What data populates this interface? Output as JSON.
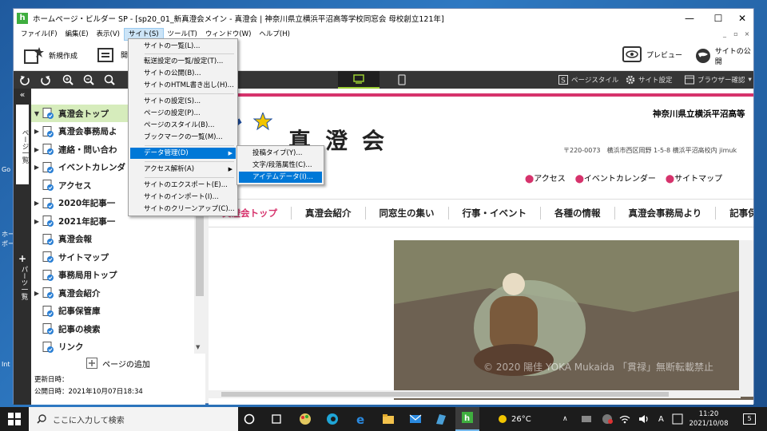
{
  "window": {
    "title": "ホームページ・ビルダー SP - [sp20_01_新真澄会メイン - 真澄会 | 神奈川県立横浜平沼高等学校同窓会 母校創立121年]",
    "app_icon": "h",
    "minimize": "—",
    "maximize": "☐",
    "close": "✕"
  },
  "menubar": [
    "ファイル(F)",
    "編集(E)",
    "表示(V)",
    "サイト(S)",
    "ツール(T)",
    "ウィンドウ(W)",
    "ヘルプ(H)"
  ],
  "toolbar": {
    "new": "新規作成",
    "open": "開",
    "preview": "プレビュー",
    "publish": "サイトの公開"
  },
  "toolbar2": {
    "page_style": "ページスタイル",
    "site_settings": "サイト設定",
    "browser_check": "ブラウザー確認"
  },
  "vtabs": {
    "pages": "ページ一覧",
    "parts": "パーツ一覧"
  },
  "tree": [
    {
      "label": "真澄会トップ",
      "expand": "▼",
      "selected": true
    },
    {
      "label": "真澄会事務局よ",
      "expand": "▶"
    },
    {
      "label": "連絡・問い合わ",
      "expand": "▶"
    },
    {
      "label": "イベントカレンダ",
      "expand": "▶"
    },
    {
      "label": "アクセス",
      "expand": ""
    },
    {
      "label": "2020年記事一",
      "expand": "▶"
    },
    {
      "label": "2021年記事一",
      "expand": "▶"
    },
    {
      "label": "真澄会報",
      "expand": ""
    },
    {
      "label": "サイトマップ",
      "expand": ""
    },
    {
      "label": "事務局用トップ",
      "expand": ""
    },
    {
      "label": "真澄会紹介",
      "expand": "▶"
    },
    {
      "label": "記事保管庫",
      "expand": ""
    },
    {
      "label": "記事の検索",
      "expand": ""
    },
    {
      "label": "リンク",
      "expand": ""
    }
  ],
  "add_page": "ページの追加",
  "dates": {
    "updated": "更新日時：",
    "published": "公開日時：2021年10月07日18:34"
  },
  "site_menu": {
    "items": [
      "サイトの一覧(L)...",
      "転送設定の一覧/設定(T)...",
      "サイトの公開(B)...",
      "サイトのHTML書き出し(H)...",
      "サイトの設定(S)...",
      "ページの設定(P)...",
      "ページのスタイル(B)...",
      "ブックマークの一覧(M)...",
      "データ管理(D)",
      "アクセス解析(A)",
      "サイトのエクスポート(E)...",
      "サイトのインポート(I)...",
      "サイトのクリーンアップ(C)..."
    ],
    "sub_arrow": "▶"
  },
  "data_submenu": [
    "投稿タイプ(Y)...",
    "文字/段落属性(C)...",
    "アイテムデータ(I)..."
  ],
  "page": {
    "school": "神奈川県立横浜平沼高等",
    "site_title": "真澄会",
    "address": "〒220-0073　横浜市西区岡野 1-5-8 横浜平沼高校内 jimuk",
    "links": [
      "アクセス",
      "イベントカレンダー",
      "サイトマップ"
    ],
    "nav": [
      "真澄会トップ",
      "真澄会紹介",
      "同窓生の集い",
      "行事・イベント",
      "各種の情報",
      "真澄会事務局より",
      "記事保"
    ],
    "watermark": "© 2020 陽佳 YOKA Mukaida 「貫禄」無断転載禁止"
  },
  "desktop_labels": [
    "ホー",
    "ポー",
    "Int",
    "Go"
  ],
  "taskbar": {
    "search": "ここに入力して検索",
    "weather": "26°C",
    "ime": "A",
    "time": "11:20",
    "date": "2021/10/08",
    "notif": "5"
  },
  "colors": {
    "accent": "#d6336c",
    "selection": "#0078d7",
    "tree_selected": "#d6ecbc"
  }
}
